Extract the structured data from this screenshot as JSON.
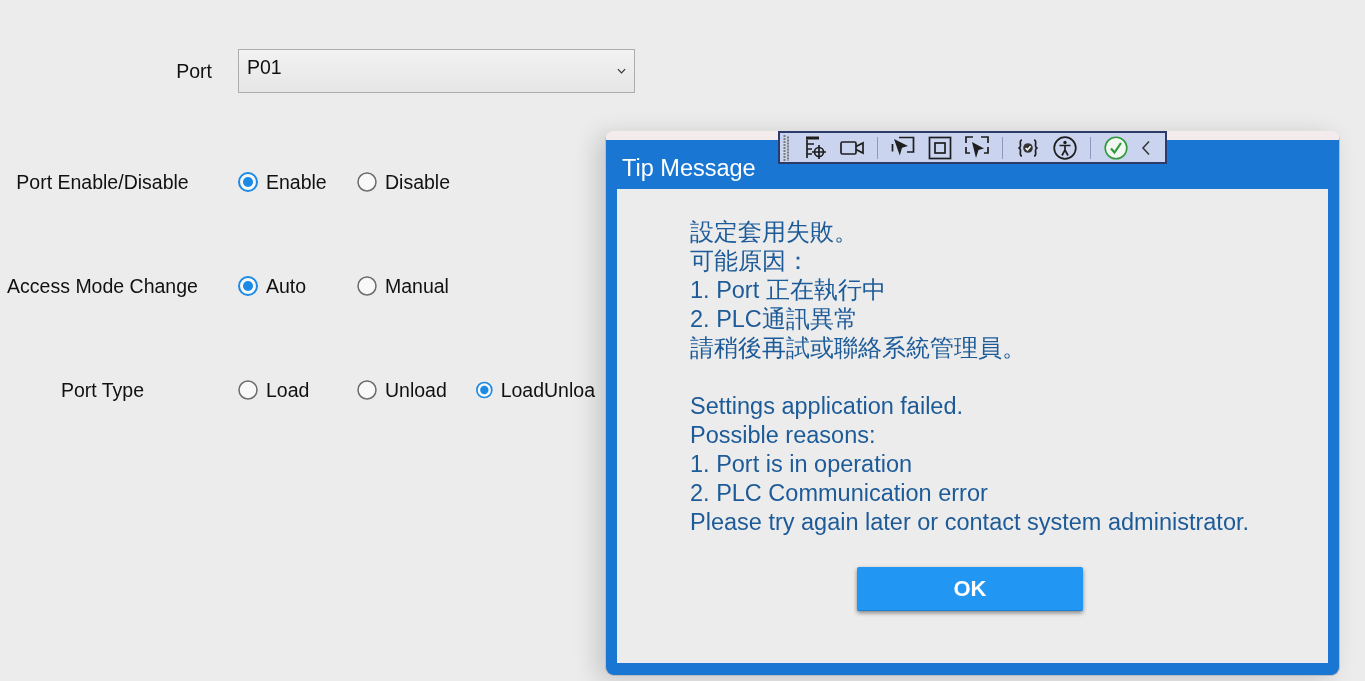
{
  "form": {
    "port": {
      "label": "Port",
      "value": "P01"
    },
    "radio_groups": [
      {
        "label": "Port Enable/Disable",
        "options": [
          {
            "label": "Enable",
            "selected": true
          },
          {
            "label": "Disable",
            "selected": false
          }
        ]
      },
      {
        "label": "Access Mode Change",
        "options": [
          {
            "label": "Auto",
            "selected": true
          },
          {
            "label": "Manual",
            "selected": false
          }
        ]
      },
      {
        "label": "Port Type",
        "options": [
          {
            "label": "Load",
            "selected": false
          },
          {
            "label": "Unload",
            "selected": false
          },
          {
            "label": "LoadUnloa",
            "selected": true
          }
        ]
      }
    ]
  },
  "dialog": {
    "title": "Tip Message",
    "message_blocks": [
      [
        "設定套用失敗。",
        "可能原因：",
        "1. Port 正在執行中",
        "2. PLC通訊異常",
        "請稍後再試或聯絡系統管理員。"
      ],
      [
        "Settings application failed.",
        "Possible reasons:",
        "1. Port is in operation",
        "2. PLC Communication error",
        "Please try again later or contact system administrator."
      ]
    ],
    "button": "OK"
  }
}
